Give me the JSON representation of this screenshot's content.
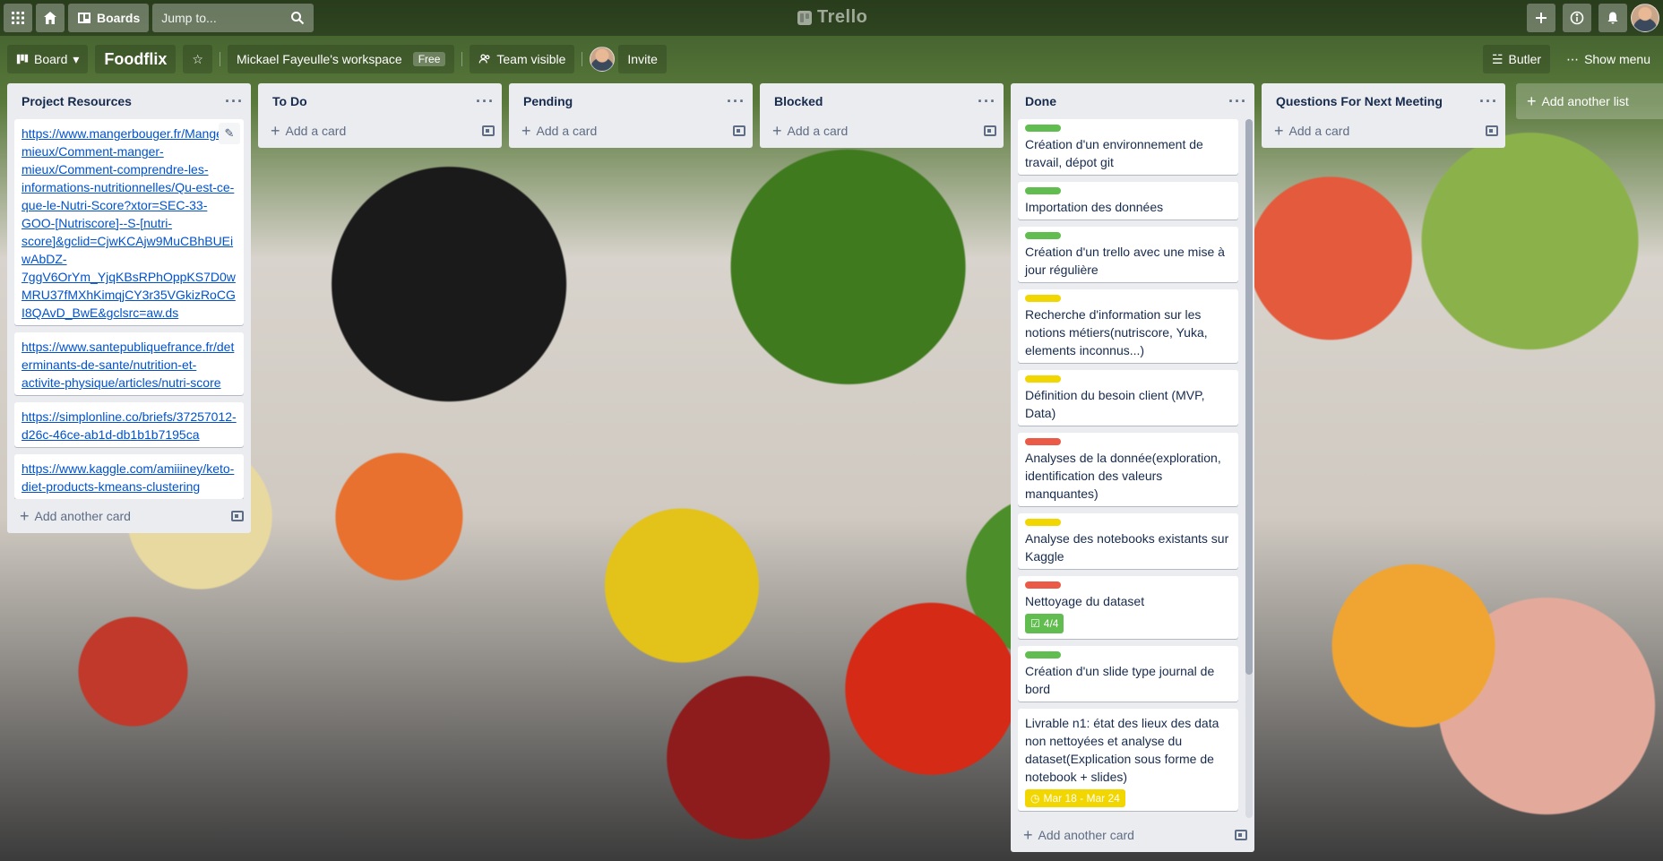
{
  "header": {
    "boards_label": "Boards",
    "search_placeholder": "Jump to...",
    "logo_text": "Trello"
  },
  "board": {
    "view_label": "Board",
    "title": "Foodflix",
    "workspace": "Mickael Fayeulle's workspace",
    "workspace_badge": "Free",
    "visibility": "Team visible",
    "invite_label": "Invite",
    "butler_label": "Butler",
    "show_menu_label": "Show menu",
    "add_list_label": "Add another list"
  },
  "lists": [
    {
      "title": "Project Resources",
      "footer": "Add another card",
      "cards": [
        {
          "link": "https://www.mangerbouger.fr/Manger-mieux/Comment-manger-mieux/Comment-comprendre-les-informations-nutritionnelles/Qu-est-ce-que-le-Nutri-Score?xtor=SEC-33-GOO-[Nutriscore]--S-[nutri-score]&gclid=CjwKCAjw9MuCBhBUEiwAbDZ-7ggV6OrYm_YjqKBsRPhOppKS7D0wMRU37fMXhKimqjCY3r35VGkizRoCGI8QAvD_BwE&gclsrc=aw.ds"
        },
        {
          "link": "https://www.santepubliquefrance.fr/determinants-de-sante/nutrition-et-activite-physique/articles/nutri-score"
        },
        {
          "link": "https://simplonline.co/briefs/37257012-d26c-46ce-ab1d-db1b1b7195ca"
        },
        {
          "link": "https://www.kaggle.com/amiiiney/keto-diet-products-kmeans-clustering"
        }
      ]
    },
    {
      "title": "To Do",
      "footer": "Add a card"
    },
    {
      "title": "Pending",
      "footer": "Add a card"
    },
    {
      "title": "Blocked",
      "footer": "Add a card"
    },
    {
      "title": "Done",
      "footer": "Add another card",
      "cards": [
        {
          "label": "green",
          "text": "Création d'un environnement de travail, dépot git"
        },
        {
          "label": "green",
          "text": "Importation des données"
        },
        {
          "label": "green",
          "text": "Création d'un trello avec une mise à jour régulière"
        },
        {
          "label": "yellow",
          "text": "Recherche d'information sur les notions métiers(nutriscore, Yuka, elements inconnus...)"
        },
        {
          "label": "yellow",
          "text": "Définition du besoin client (MVP, Data)"
        },
        {
          "label": "red",
          "text": "Analyses de la donnée(exploration, identification des valeurs manquantes)"
        },
        {
          "label": "yellow",
          "text": "Analyse des notebooks existants sur Kaggle"
        },
        {
          "label": "red",
          "text": "Nettoyage du dataset",
          "checklist": "4/4"
        },
        {
          "label": "green",
          "text": "Création d'un slide type journal de bord"
        },
        {
          "text": "Livrable n1: état des lieux des data non nettoyées et analyse du dataset(Explication sous forme de notebook + slides)",
          "date": "Mar 18 - Mar 24"
        }
      ]
    },
    {
      "title": "Questions For Next Meeting",
      "footer": "Add a card"
    }
  ],
  "colors": {
    "label_green": "#61bd4f",
    "label_yellow": "#f2d600",
    "label_red": "#eb5a46",
    "list_bg": "#ebecf0",
    "link": "#0052cc"
  }
}
